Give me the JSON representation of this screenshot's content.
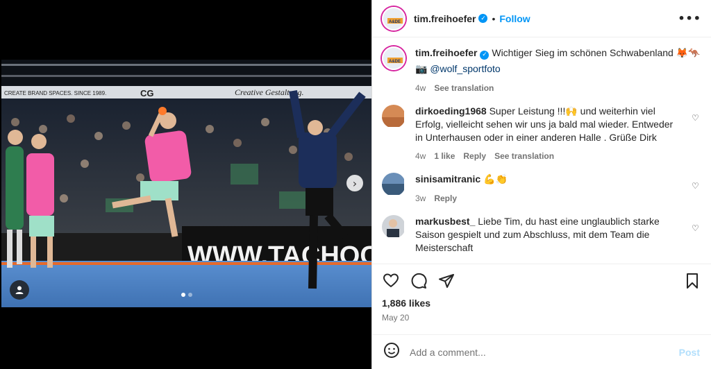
{
  "post": {
    "username": "tim.freihoefer",
    "follow_label": "Follow",
    "more_label": "•••"
  },
  "caption": {
    "username": "tim.freihoefer",
    "text": "Wichtiger Sieg im schönen Schwabenland 🦊🦘",
    "camera_emoji": "📷",
    "mention": "@wolf_sportfoto",
    "time": "4w",
    "see_translation": "See translation"
  },
  "comments": [
    {
      "username": "dirkoeding1968",
      "text": "Super Leistung !!!🙌 und weiterhin viel Erfolg, vielleicht sehen wir uns ja bald mal wieder. Entweder in Unterhausen oder in einer anderen Halle . Grüße Dirk",
      "time": "4w",
      "likes": "1 like",
      "reply": "Reply",
      "see_translation": "See translation"
    },
    {
      "username": "sinisamitranic",
      "text": "💪👏",
      "time": "3w",
      "reply": "Reply"
    },
    {
      "username": "markusbest_",
      "text": "Liebe Tim, du hast eine unglaublich starke Saison gespielt und zum Abschluss, mit dem Team die Meisterschaft"
    }
  ],
  "stats": {
    "likes": "1,886 likes",
    "date": "May 20"
  },
  "composer": {
    "placeholder": "Add a comment...",
    "post_label": "Post"
  },
  "media": {
    "next_arrow": "›",
    "slide_count": 2,
    "active_slide": 0,
    "banner_text": "WWW.TACHOCON",
    "top_sign_left": "CREATE BRAND SPACES. SINCE 1989.",
    "top_sign_logo": "CG",
    "top_sign_right": "Creative Gestaltung."
  },
  "icons": {
    "heart": "heart-icon",
    "comment": "comment-icon",
    "share": "share-icon",
    "bookmark": "bookmark-icon",
    "emoji": "emoji-icon",
    "user_tag": "user-tag-icon"
  },
  "colors": {
    "accent": "#0095f6",
    "jersey_pink": "#f25ca8",
    "jersey_green": "#2e7d4f",
    "court_blue": "#4a7fc1"
  }
}
